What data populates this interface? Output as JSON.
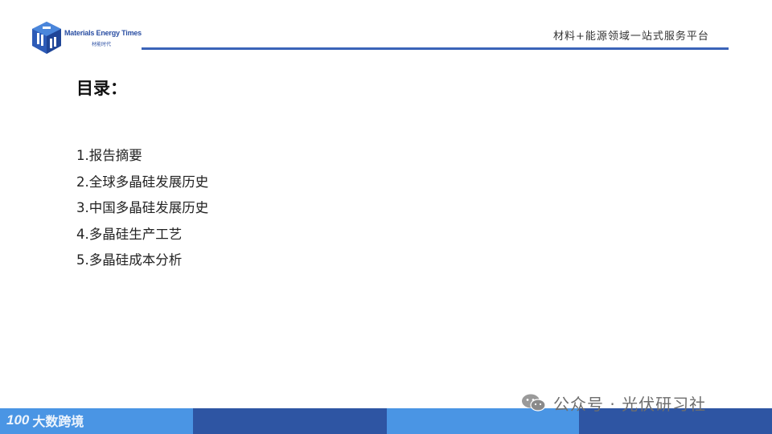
{
  "header": {
    "logo_name_en": "Materials Energy Times",
    "logo_name_cn": "材能时代",
    "tagline": "材料+能源领域一站式服务平台",
    "accent_color": "#3a63b8"
  },
  "toc": {
    "title": "目录：",
    "items": [
      "1.报告摘要",
      "2.全球多晶硅发展历史",
      "3.中国多晶硅发展历史",
      "4.多晶硅生产工艺",
      "5.多晶硅成本分析"
    ]
  },
  "footer": {
    "brand_logo": "100",
    "brand_text": "大数跨境",
    "bar_colors": [
      "#4a95e4",
      "#2e55a3",
      "#4a95e4",
      "#2e55a3"
    ]
  },
  "watermark": {
    "icon": "wechat-icon",
    "text": "公众号 · 光伏研习社"
  }
}
